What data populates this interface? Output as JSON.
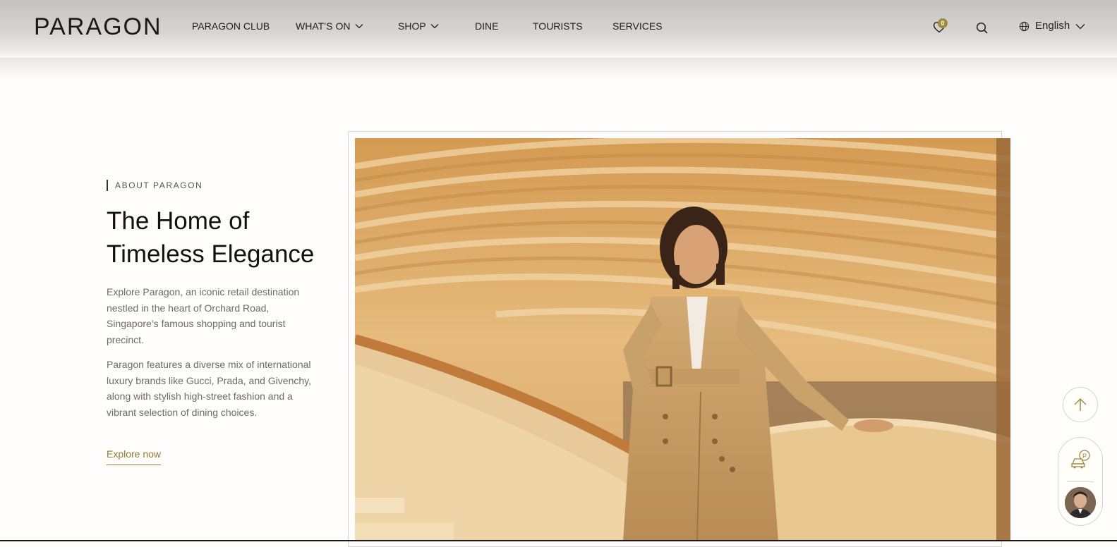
{
  "header": {
    "logo": "PARAGON",
    "nav": [
      {
        "label": "PARAGON CLUB",
        "dropdown": false
      },
      {
        "label": "WHAT’S ON",
        "dropdown": true
      },
      {
        "label": "SHOP",
        "dropdown": true
      },
      {
        "label": "DINE",
        "dropdown": false
      },
      {
        "label": "TOURISTS",
        "dropdown": false
      },
      {
        "label": "SERVICES",
        "dropdown": false
      }
    ],
    "wishlist_icon": "heart-icon",
    "wishlist_count": "0",
    "search_icon": "search-icon",
    "language_icon": "globe-icon",
    "language": "English"
  },
  "about": {
    "eyebrow": "ABOUT PARAGON",
    "title": "The Home of Timeless Elegance",
    "paragraph1": "Explore Paragon, an iconic retail destination nestled in the heart of Orchard Road, Singapore’s famous shopping and tourist precinct.",
    "paragraph2": "Paragon features a diverse mix of international luxury brands like Gucci, Prada, and Givenchy, along with stylish high-street fashion and a vibrant selection of dining choices.",
    "cta": "Explore now"
  },
  "floating": {
    "back_to_top_icon": "arrow-up-icon",
    "parking_icon": "car-parking-icon",
    "assistant_avatar": "avatar"
  },
  "colors": {
    "accent_gold": "#8f7b33",
    "badge_gold": "#a08a3c",
    "background": "#fefdfb"
  }
}
